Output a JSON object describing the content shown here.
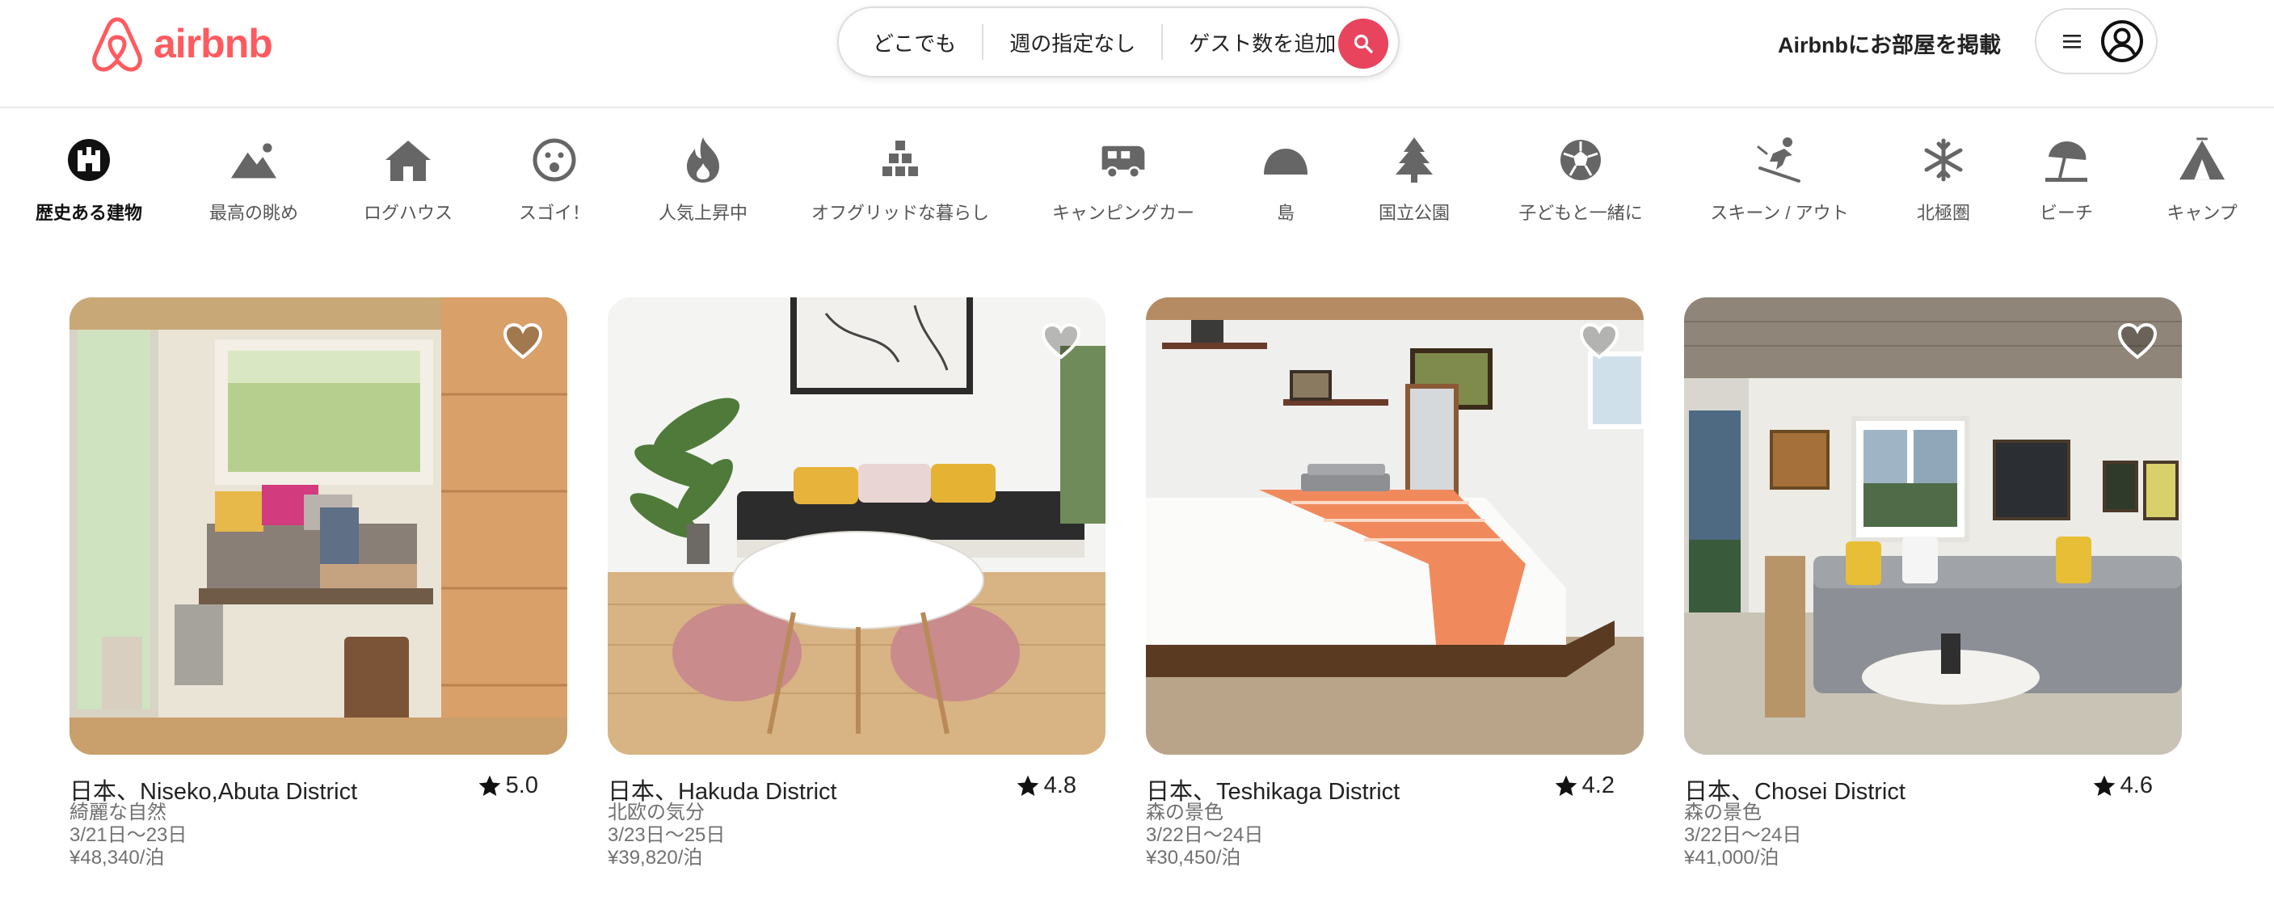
{
  "brand": {
    "name": "airbnb",
    "color": "#ff5a5f"
  },
  "search": {
    "where": "どこでも",
    "when": "週の指定なし",
    "guests": "ゲスト数を追加",
    "accent": "#e8445e"
  },
  "header": {
    "host_link": "Airbnbにお部屋を掲載"
  },
  "categories": [
    {
      "label": "歴史ある建物",
      "icon": "castle-icon"
    },
    {
      "label": "最高の眺め",
      "icon": "mountain-view-icon"
    },
    {
      "label": "ログハウス",
      "icon": "cabin-icon"
    },
    {
      "label": "スゴイ！",
      "icon": "wow-face-icon"
    },
    {
      "label": "人気上昇中",
      "icon": "flame-icon"
    },
    {
      "label": "オフグリッドな暮らし",
      "icon": "off-grid-icon"
    },
    {
      "label": "キャンピングカー",
      "icon": "camper-icon"
    },
    {
      "label": "島",
      "icon": "island-icon"
    },
    {
      "label": "国立公園",
      "icon": "pine-tree-icon"
    },
    {
      "label": "子どもと一緒に",
      "icon": "ball-icon"
    },
    {
      "label": "スキーン / アウト",
      "icon": "skier-icon"
    },
    {
      "label": "北極圏",
      "icon": "snowflake-icon"
    },
    {
      "label": "ビーチ",
      "icon": "beach-umbrella-icon"
    },
    {
      "label": "キャンプ",
      "icon": "tent-icon"
    }
  ],
  "listings": [
    {
      "location": "日本、Niseko,Abuta District",
      "rating": "5.0",
      "tagline": "綺麗な自然",
      "dates": "3/21日～23日",
      "price": "¥48,340/泊"
    },
    {
      "location": "日本、Hakuda District",
      "rating": "4.8",
      "tagline": "北欧の気分",
      "dates": "3/23日～25日",
      "price": "¥39,820/泊"
    },
    {
      "location": "日本、Teshikaga District",
      "rating": "4.2",
      "tagline": "森の景色",
      "dates": "3/22日～24日",
      "price": "¥30,450/泊"
    },
    {
      "location": "日本、Chosei District",
      "rating": "4.6",
      "tagline": "森の景色",
      "dates": "3/22日～24日",
      "price": "¥41,000/泊"
    }
  ]
}
